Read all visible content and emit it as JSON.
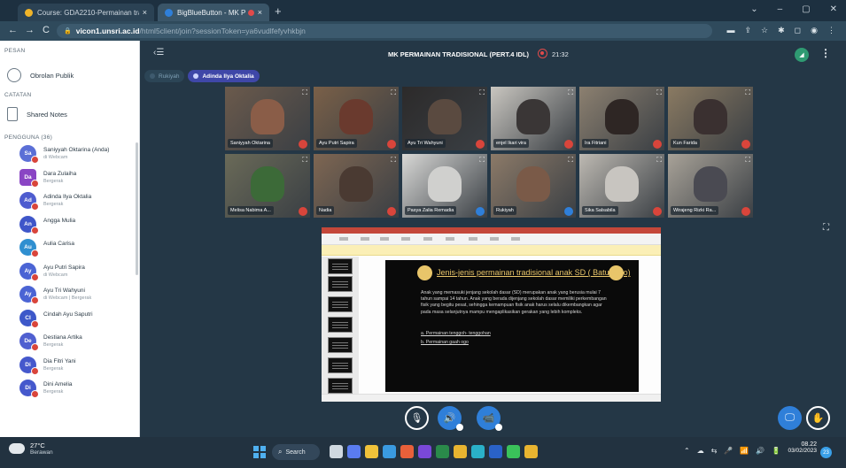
{
  "browser": {
    "tabs": [
      {
        "title": "Course: GDA2210-Permainan tra",
        "close": "×"
      },
      {
        "title": "BigBlueButton - MK PERMAI",
        "close": "×"
      }
    ],
    "new_tab": "+",
    "window_controls": [
      "⌄",
      "–",
      "▢",
      "✕"
    ],
    "nav": {
      "back": "←",
      "forward": "→",
      "reload": "C"
    },
    "url_host": "vicon1.unsri.ac.id",
    "url_path": "/html5client/join?sessionToken=ya6vudlfefyvhkbjn",
    "extensions": [
      "▬",
      "⇪",
      "☆",
      "✱",
      "◻",
      "◉",
      "⋮"
    ]
  },
  "sidebar": {
    "messages_header": "PESAN",
    "public_chat": "Obrolan Publik",
    "notes_header": "CATATAN",
    "shared_notes": "Shared Notes",
    "users_header": "PENGGUNA (36)",
    "users": [
      {
        "initials": "Sa",
        "name": "Saniyyah Oktarina (Anda)",
        "status": "di Webcam",
        "color": "#5b6fd6",
        "shape": "circle"
      },
      {
        "initials": "Da",
        "name": "Dara Zulaiha",
        "status": "Bergerak",
        "color": "#8a45c4",
        "shape": "square"
      },
      {
        "initials": "Ad",
        "name": "Adinda Ilya Oktalia",
        "status": "Bergerak",
        "color": "#4e5ccf",
        "shape": "circle"
      },
      {
        "initials": "An",
        "name": "Angga Mulia",
        "status": "",
        "color": "#3f56c9",
        "shape": "circle"
      },
      {
        "initials": "Au",
        "name": "Aulia Carisa",
        "status": "",
        "color": "#2f8fd0",
        "shape": "circle"
      },
      {
        "initials": "Ay",
        "name": "Ayu Putri Sapira",
        "status": "di Webcam",
        "color": "#4b64d4",
        "shape": "circle"
      },
      {
        "initials": "Ay",
        "name": "Ayu Tri Wahyuni",
        "status": "di Webcam | Bergerak",
        "color": "#4b64d4",
        "shape": "circle"
      },
      {
        "initials": "CI",
        "name": "Cindah Ayu Saputri",
        "status": "",
        "color": "#3d58c9",
        "shape": "circle"
      },
      {
        "initials": "De",
        "name": "Destiana Artika",
        "status": "Bergerak",
        "color": "#4f5fd0",
        "shape": "circle"
      },
      {
        "initials": "Di",
        "name": "Dia Fitri Yani",
        "status": "Bergerak",
        "color": "#4558cc",
        "shape": "circle"
      },
      {
        "initials": "Di",
        "name": "Dini Amelia",
        "status": "Bergerak",
        "color": "#4558cc",
        "shape": "circle"
      }
    ]
  },
  "meeting": {
    "title": "MK PERMAINAN TRADISIONAL (PERT.4 IDL)",
    "record_time": "21:32",
    "talking": [
      "Rukiyah",
      "Adinda Ilya Oktalia"
    ],
    "tiles": [
      {
        "name": "Saniyyah Oktarina",
        "mic": "muted",
        "tone": "#6b5a4c",
        "face": "#8a5d48"
      },
      {
        "name": "Ayu Putri Sapira",
        "mic": "muted",
        "tone": "#7a6048",
        "face": "#6a3a2e"
      },
      {
        "name": "Ayu Tri Wahyuni",
        "mic": "muted",
        "tone": "#2c2a2a",
        "face": "#5a4a40"
      },
      {
        "name": "enjel Ikari vira",
        "mic": "muted",
        "tone": "#c9c6c0",
        "face": "#3a3636"
      },
      {
        "name": "Ira Fitriani",
        "mic": "muted",
        "tone": "#8c8070",
        "face": "#2e2624"
      },
      {
        "name": "Kun Farida",
        "mic": "muted",
        "tone": "#8a7a62",
        "face": "#3a3030"
      },
      {
        "name": "Melisa Nabima A...",
        "mic": "muted",
        "tone": "#6a6a58",
        "face": "#3c6a38"
      },
      {
        "name": "Nadia",
        "mic": "muted",
        "tone": "#7e6652",
        "face": "#4a3a32"
      },
      {
        "name": "Pasya Zalia Remadia",
        "mic": "on",
        "tone": "#d8d8d6",
        "face": "#d0d0ce"
      },
      {
        "name": "Rukiyah",
        "mic": "on",
        "tone": "#8c7a68",
        "face": "#7a5a48"
      },
      {
        "name": "Sika Salsabila",
        "mic": "muted",
        "tone": "#bdb9b2",
        "face": "#c8c5c0"
      },
      {
        "name": "Wirajeng Rizki Ra...",
        "mic": "muted",
        "tone": "#a8a298",
        "face": "#4a4a52"
      }
    ],
    "expand_icon": "⛶"
  },
  "presentation": {
    "slide_title": "Jenis-jenis permainan tradisional anak SD ( Batu Rajo)",
    "slide_paragraph": "Anak yang memasuki jenjang sekolah dasar (SD) merupakan anak yang berusia mulai 7 tahun sampai 14 tahun. Anak yang berada dijenjang sekolah dasar memiliki perkembangan fisik yang begitu pesat, sehingga kemampuan fisik anak harus selalu dikembangkan agar pada masa selanjutnya mampu mengaplikasikan gerakan yang lebih kompleks.",
    "slide_list": [
      "a.  Permainan tenggoh- tenggohan",
      "b.  Permainan gaah ogo"
    ]
  },
  "actions": {
    "mic": "🎙",
    "audio": "🔊",
    "camera": "📹",
    "present": "🖵",
    "raise_hand": "✋"
  },
  "taskbar": {
    "temperature": "27°C",
    "weather": "Berawan",
    "search": "Search",
    "time": "08.22",
    "date": "03/02/2023",
    "notifications": "23",
    "tray": [
      "⌃",
      "☁",
      "⇆",
      "🎤",
      "📶",
      "🔊",
      "🔋"
    ],
    "apps": [
      {
        "name": "task-view",
        "color": "#cfd8e0"
      },
      {
        "name": "meet",
        "color": "#5a7cf0"
      },
      {
        "name": "file-explorer",
        "color": "#f0c23a"
      },
      {
        "name": "store",
        "color": "#3a9ae0"
      },
      {
        "name": "app-orange",
        "color": "#e8603a"
      },
      {
        "name": "app-purple",
        "color": "#7a48d8"
      },
      {
        "name": "excel",
        "color": "#2a8a4a"
      },
      {
        "name": "chrome",
        "color": "#e8b430"
      },
      {
        "name": "edge",
        "color": "#2ab0c8"
      },
      {
        "name": "word",
        "color": "#2a62c8"
      },
      {
        "name": "whatsapp",
        "color": "#3ac25a"
      },
      {
        "name": "chrome-2",
        "color": "#e8b430"
      }
    ]
  }
}
